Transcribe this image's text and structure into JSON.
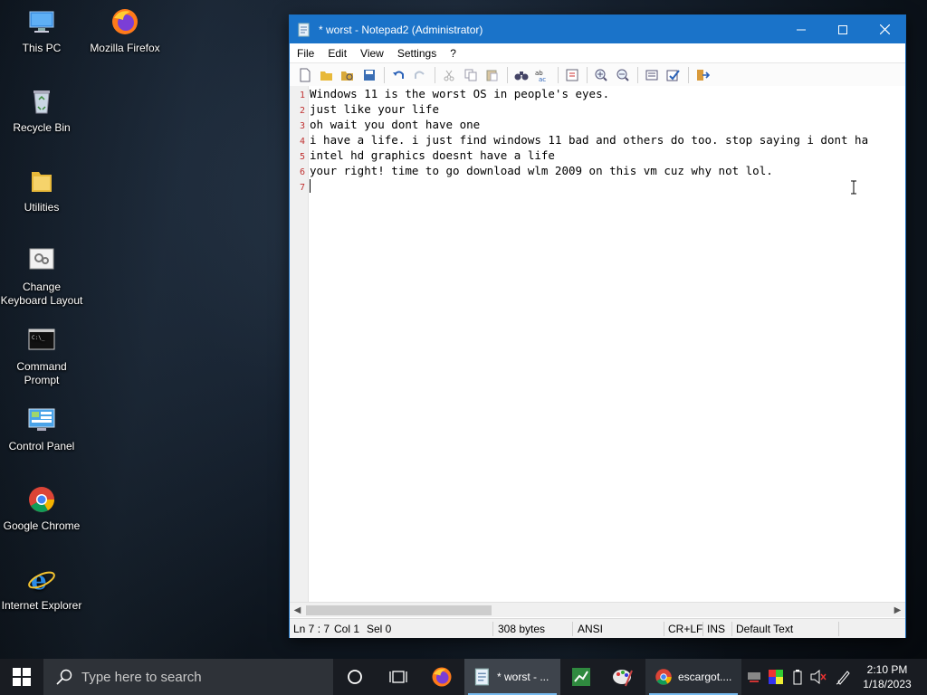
{
  "desktop": {
    "icons": [
      {
        "label": "This PC"
      },
      {
        "label": "Mozilla Firefox"
      },
      {
        "label": "Recycle Bin"
      },
      {
        "label": "Utilities"
      },
      {
        "label": "Change Keyboard Layout"
      },
      {
        "label": "Command Prompt"
      },
      {
        "label": "Control Panel"
      },
      {
        "label": "Google Chrome"
      },
      {
        "label": "Internet Explorer"
      }
    ]
  },
  "window": {
    "title": "* worst - Notepad2 (Administrator)",
    "menu": [
      "File",
      "Edit",
      "View",
      "Settings",
      "?"
    ],
    "toolbar_icons": [
      "new-file-icon",
      "open-file-icon",
      "browse-icon",
      "save-icon",
      "undo-icon",
      "redo-icon",
      "cut-icon",
      "copy-icon",
      "paste-icon",
      "find-icon",
      "replace-icon",
      "goto-icon",
      "zoom-in-icon",
      "zoom-out-icon",
      "scheme-icon",
      "customize-icon",
      "exit-icon"
    ],
    "lines": [
      {
        "num": "1",
        "text": "Windows 11 is the worst OS in people's eyes."
      },
      {
        "num": "2",
        "text": "just like your life"
      },
      {
        "num": "3",
        "text": "oh wait you dont have one"
      },
      {
        "num": "4",
        "text": "i have a life. i just find windows 11 bad and others do too. stop saying i dont ha"
      },
      {
        "num": "5",
        "text": "intel hd graphics doesnt have a life"
      },
      {
        "num": "6",
        "text": "your right! time to go download wlm 2009 on this vm cuz why not lol."
      },
      {
        "num": "7",
        "text": ""
      }
    ],
    "status": {
      "position": "Ln 7 : 7",
      "col": "Col 1",
      "sel": "Sel 0",
      "size": "308 bytes",
      "encoding": "ANSI",
      "eol": "CR+LF",
      "mode": "INS",
      "scheme": "Default Text"
    }
  },
  "taskbar": {
    "search_placeholder": "Type here to search",
    "apps": [
      {
        "label": "* worst - ..."
      },
      {
        "label": "escargot...."
      }
    ],
    "time": "2:10 PM",
    "date": "1/18/2023"
  },
  "colors": {
    "titlebar": "#1a73c9",
    "taskbar": "#191c22",
    "line_numbers": "#c03030"
  }
}
